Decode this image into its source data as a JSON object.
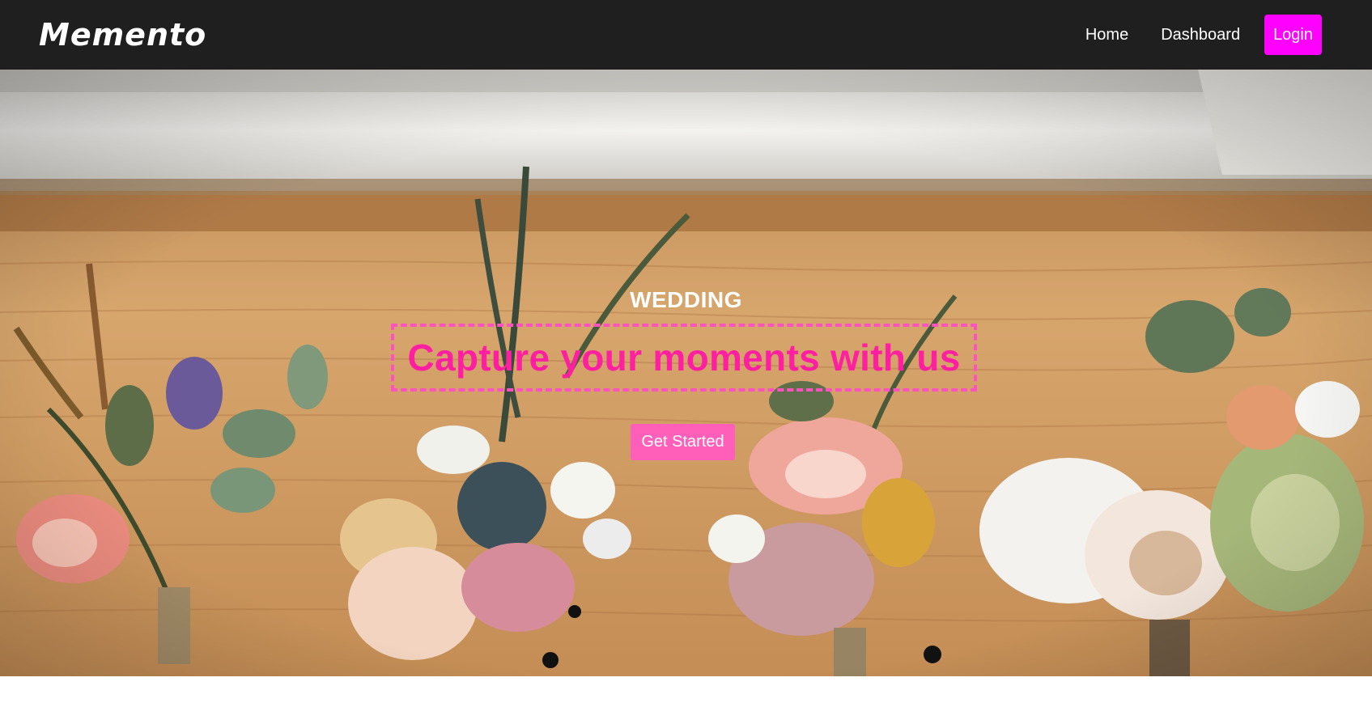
{
  "navbar": {
    "brand": "Memento",
    "links": [
      {
        "label": "Home"
      },
      {
        "label": "Dashboard"
      }
    ],
    "login_label": "Login"
  },
  "hero": {
    "eyebrow": "WEDDING",
    "headline": "Capture your moments with us",
    "cta_label": "Get Started",
    "background_image": "boutonniere-flowers-on-wooden-windowsill"
  },
  "colors": {
    "navbar_bg": "#1f1f1f",
    "login_bg": "#ff00ff",
    "headline": "#ff1fa0",
    "headline_border": "#ff52c0",
    "cta_bg": "#ff5fb8"
  }
}
